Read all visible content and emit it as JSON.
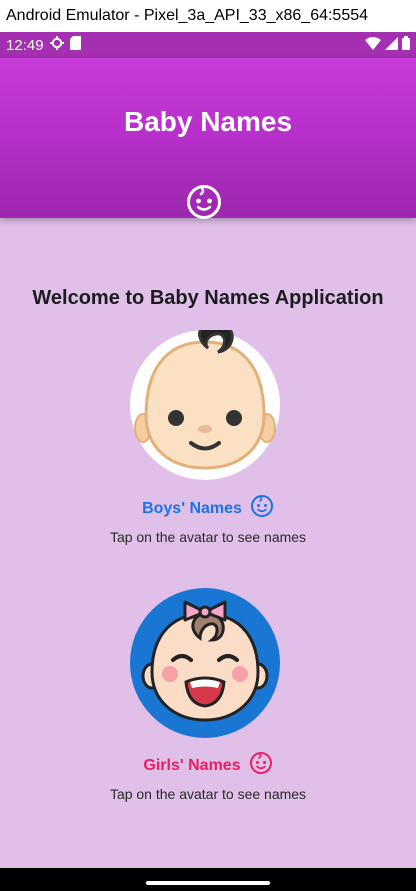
{
  "window": {
    "title": "Android Emulator - Pixel_3a_API_33_x86_64:5554"
  },
  "status_bar": {
    "time": "12:49"
  },
  "app_bar": {
    "title": "Baby Names",
    "icon": "baby-face-icon"
  },
  "main": {
    "welcome": "Welcome to Baby Names Application",
    "boys": {
      "label": "Boys' Names",
      "hint": "Tap on the avatar to see names",
      "color": "#1a73e8"
    },
    "girls": {
      "label": "Girls' Names",
      "hint": "Tap on the avatar to see names",
      "color": "#e91e63"
    }
  },
  "colors": {
    "app_bar": "#b42ec8",
    "background": "#e0bfe8",
    "status_bar": "#a42fb0"
  }
}
